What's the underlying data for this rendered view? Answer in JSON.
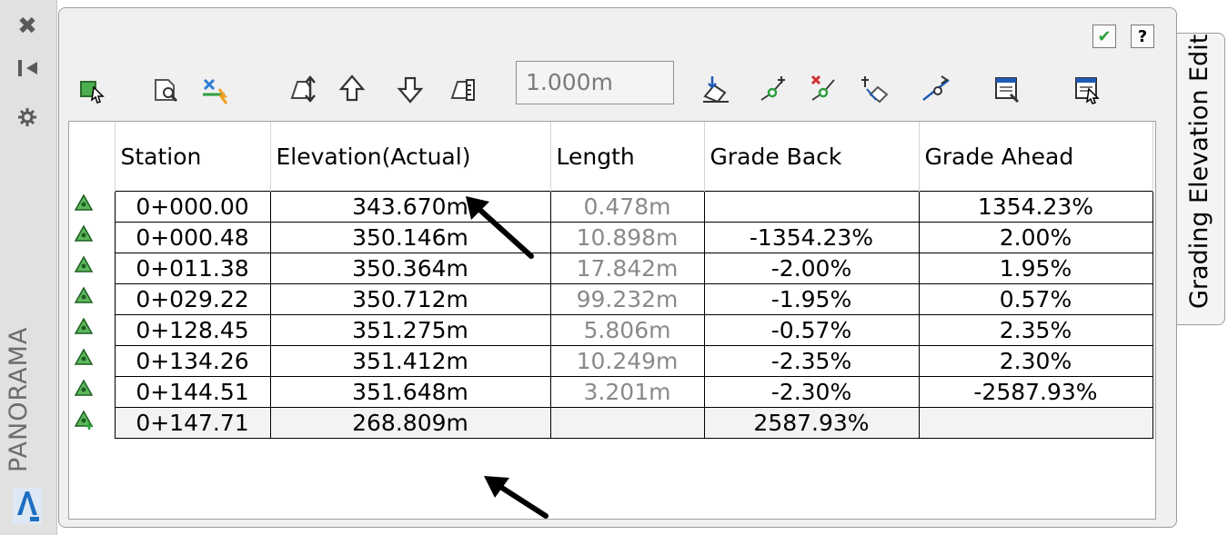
{
  "palette": {
    "name": "PANORAMA",
    "tab_label": "Grading Elevation Edit",
    "left_icons": [
      "close-icon",
      "auto-hide-icon",
      "properties-icon"
    ],
    "top_right": [
      "check-icon",
      "help-icon"
    ],
    "help_glyph": "?"
  },
  "toolbar": {
    "increment_value": "1.000m",
    "icons": [
      "select-feature-line-icon",
      "zoom-to-icon",
      "filter-points-icon",
      "raise-lower-icon",
      "raise-icon",
      "lower-icon",
      "set-increment-icon",
      "flatten-grade-icon",
      "insert-pi-icon",
      "delete-pi-icon",
      "elevation-from-surface-icon",
      "reverse-icon",
      "unselect-icon",
      "select-entity-icon"
    ]
  },
  "table": {
    "columns": [
      "Station",
      "Elevation(Actual)",
      "Length",
      "Grade Back",
      "Grade Ahead"
    ],
    "rows": [
      {
        "station": "0+000.00",
        "elevation": "343.670m",
        "length": "0.478m",
        "grade_back": "",
        "grade_ahead": "1354.23%"
      },
      {
        "station": "0+000.48",
        "elevation": "350.146m",
        "length": "10.898m",
        "grade_back": "-1354.23%",
        "grade_ahead": "2.00%"
      },
      {
        "station": "0+011.38",
        "elevation": "350.364m",
        "length": "17.842m",
        "grade_back": "-2.00%",
        "grade_ahead": "1.95%"
      },
      {
        "station": "0+029.22",
        "elevation": "350.712m",
        "length": "99.232m",
        "grade_back": "-1.95%",
        "grade_ahead": "0.57%"
      },
      {
        "station": "0+128.45",
        "elevation": "351.275m",
        "length": "5.806m",
        "grade_back": "-0.57%",
        "grade_ahead": "2.35%"
      },
      {
        "station": "0+134.26",
        "elevation": "351.412m",
        "length": "10.249m",
        "grade_back": "-2.35%",
        "grade_ahead": "2.30%"
      },
      {
        "station": "0+144.51",
        "elevation": "351.648m",
        "length": "3.201m",
        "grade_back": "-2.30%",
        "grade_ahead": "-2587.93%"
      },
      {
        "station": "0+147.71",
        "elevation": "268.809m",
        "length": "",
        "grade_back": "2587.93%",
        "grade_ahead": ""
      }
    ]
  },
  "colors": {
    "marker_green": "#2e9e3e",
    "frame_bg": "#f0f0f0"
  }
}
